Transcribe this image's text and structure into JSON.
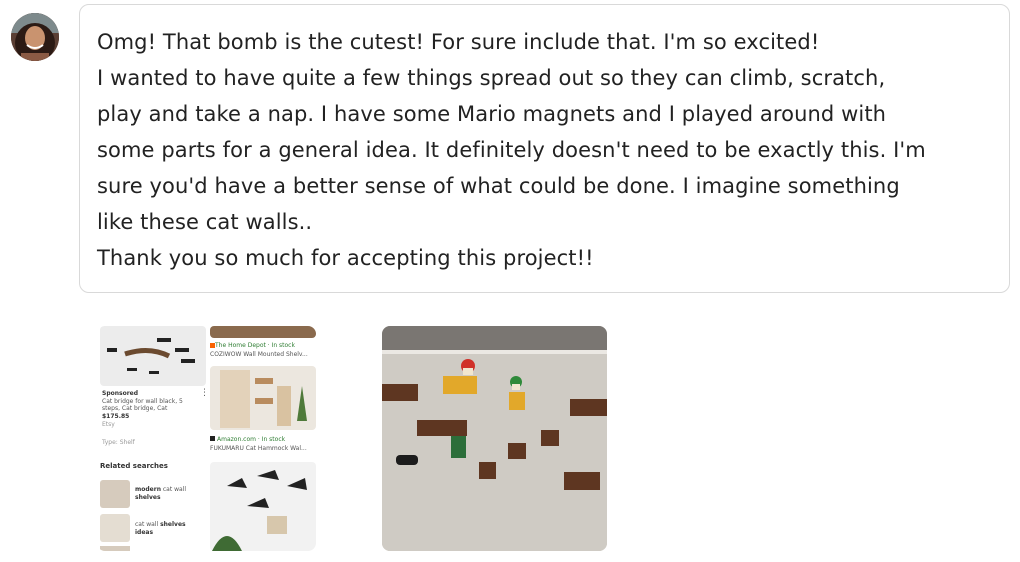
{
  "message": {
    "lines": [
      "Omg! That bomb is the cutest! For sure include that. I'm so excited!",
      "I wanted to have quite a few things spread out so they can climb, scratch,",
      "play and take a nap. I have some Mario magnets and I played around with",
      "some parts for a general idea. It definitely doesn't need to be exactly this. I'm",
      "sure you'd have a better sense of what could be done. I imagine something",
      "like these cat walls..",
      "Thank you so much for accepting this project!!"
    ]
  },
  "attachment1": {
    "store1": "The Home Depot · In stock",
    "product1": "COZIWOW Wall Mounted Shelv...",
    "sponsored": "Sponsored",
    "desc1": "Cat bridge for wall black, 5",
    "desc2": "steps, Cat bridge, Cat",
    "price": "$175.85",
    "seller": "Etsy",
    "type": "Type: Shelf",
    "store2": "Amazon.com · In stock",
    "product2": "FUKUMARU Cat Hammock Wal...",
    "related": "Related searches",
    "search1_bold": "modern",
    "search1_rest": " cat wall",
    "search1_line2": "shelves",
    "search2_rest": "cat wall ",
    "search2_bold": "shelves",
    "search2_line2": "ideas"
  },
  "colors": {
    "border": "#d9d9d9",
    "text": "#222222",
    "stock": "#2e7d32",
    "store_icon": "#f96302"
  }
}
